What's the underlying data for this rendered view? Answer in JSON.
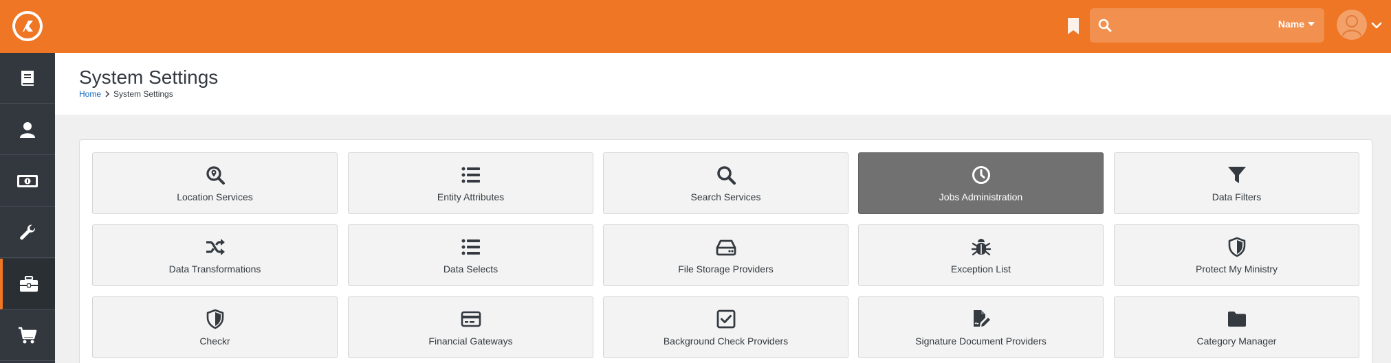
{
  "colors": {
    "brand_orange": "#ee7624",
    "sidebar_dark": "#32383e",
    "link_blue": "#0f68c2",
    "active_tile": "#717171"
  },
  "topbar": {
    "logo_icon": "rock-logo-icon",
    "bookmark_icon": "bookmark-icon",
    "search": {
      "icon": "search-icon",
      "value": "",
      "placeholder": "",
      "filter_label": "Name"
    },
    "user_icon": "user-avatar-icon"
  },
  "sidebar": {
    "items": [
      {
        "name": "book",
        "icon": "book-icon",
        "active": false
      },
      {
        "name": "people",
        "icon": "user-icon",
        "active": false
      },
      {
        "name": "finance",
        "icon": "money-icon",
        "active": false
      },
      {
        "name": "tools",
        "icon": "wrench-icon",
        "active": false
      },
      {
        "name": "admin",
        "icon": "briefcase-icon",
        "active": true
      },
      {
        "name": "shop",
        "icon": "cart-icon",
        "active": false
      }
    ]
  },
  "header": {
    "title": "System Settings",
    "breadcrumb": {
      "home": "Home",
      "current": "System Settings"
    }
  },
  "tiles": [
    {
      "label": "Location Services",
      "icon": "search-location-icon",
      "active": false
    },
    {
      "label": "Entity Attributes",
      "icon": "list-icon",
      "active": false
    },
    {
      "label": "Search Services",
      "icon": "search-icon",
      "active": false
    },
    {
      "label": "Jobs Administration",
      "icon": "clock-icon",
      "active": true
    },
    {
      "label": "Data Filters",
      "icon": "filter-icon",
      "active": false
    },
    {
      "label": "Data Transformations",
      "icon": "random-icon",
      "active": false
    },
    {
      "label": "Data Selects",
      "icon": "list-icon",
      "active": false
    },
    {
      "label": "File Storage Providers",
      "icon": "hdd-icon",
      "active": false
    },
    {
      "label": "Exception List",
      "icon": "bug-icon",
      "active": false
    },
    {
      "label": "Protect My Ministry",
      "icon": "shield-icon",
      "active": false
    },
    {
      "label": "Checkr",
      "icon": "shield-icon",
      "active": false
    },
    {
      "label": "Financial Gateways",
      "icon": "credit-card-icon",
      "active": false
    },
    {
      "label": "Background Check Providers",
      "icon": "check-square-icon",
      "active": false
    },
    {
      "label": "Signature Document Providers",
      "icon": "file-signature-icon",
      "active": false
    },
    {
      "label": "Category Manager",
      "icon": "folder-icon",
      "active": false
    }
  ]
}
